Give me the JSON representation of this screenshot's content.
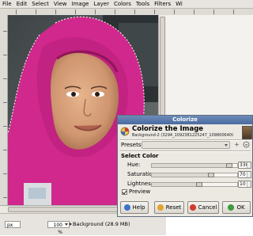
{
  "menubar": {
    "items": [
      "File",
      "Edit",
      "Select",
      "View",
      "Image",
      "Layer",
      "Colors",
      "Tools",
      "Filters",
      "Wi"
    ]
  },
  "statusbar": {
    "unit": "px",
    "zoom": "100 %",
    "layer_info": "Background (28.9 MB)"
  },
  "dialog": {
    "window_title": "Colorize",
    "heading": "Colorize the Image",
    "subheading": "Background-2 (3294_1092381225247_1098006409_304...",
    "presets_label": "Presets:",
    "select_color_label": "Select Color",
    "hue_label": "Hue:",
    "hue_value": "330",
    "hue_fraction": 0.917,
    "saturation_label": "Saturation:",
    "saturation_value": "70",
    "saturation_fraction": 0.7,
    "lightness_label": "Lightness:",
    "lightness_value": "10",
    "lightness_fraction": 0.55,
    "preview_label": "Preview",
    "preview_checked": true,
    "buttons": {
      "help": "Help",
      "reset": "Reset",
      "cancel": "Cancel",
      "ok": "OK"
    }
  },
  "colors": {
    "hijab": "#d0288c",
    "title_bar": "#5678ac"
  },
  "icons": {
    "colorize": "colorize-icon",
    "help": "help-icon",
    "reset": "reset-icon",
    "cancel": "cancel-icon",
    "ok": "ok-icon"
  }
}
